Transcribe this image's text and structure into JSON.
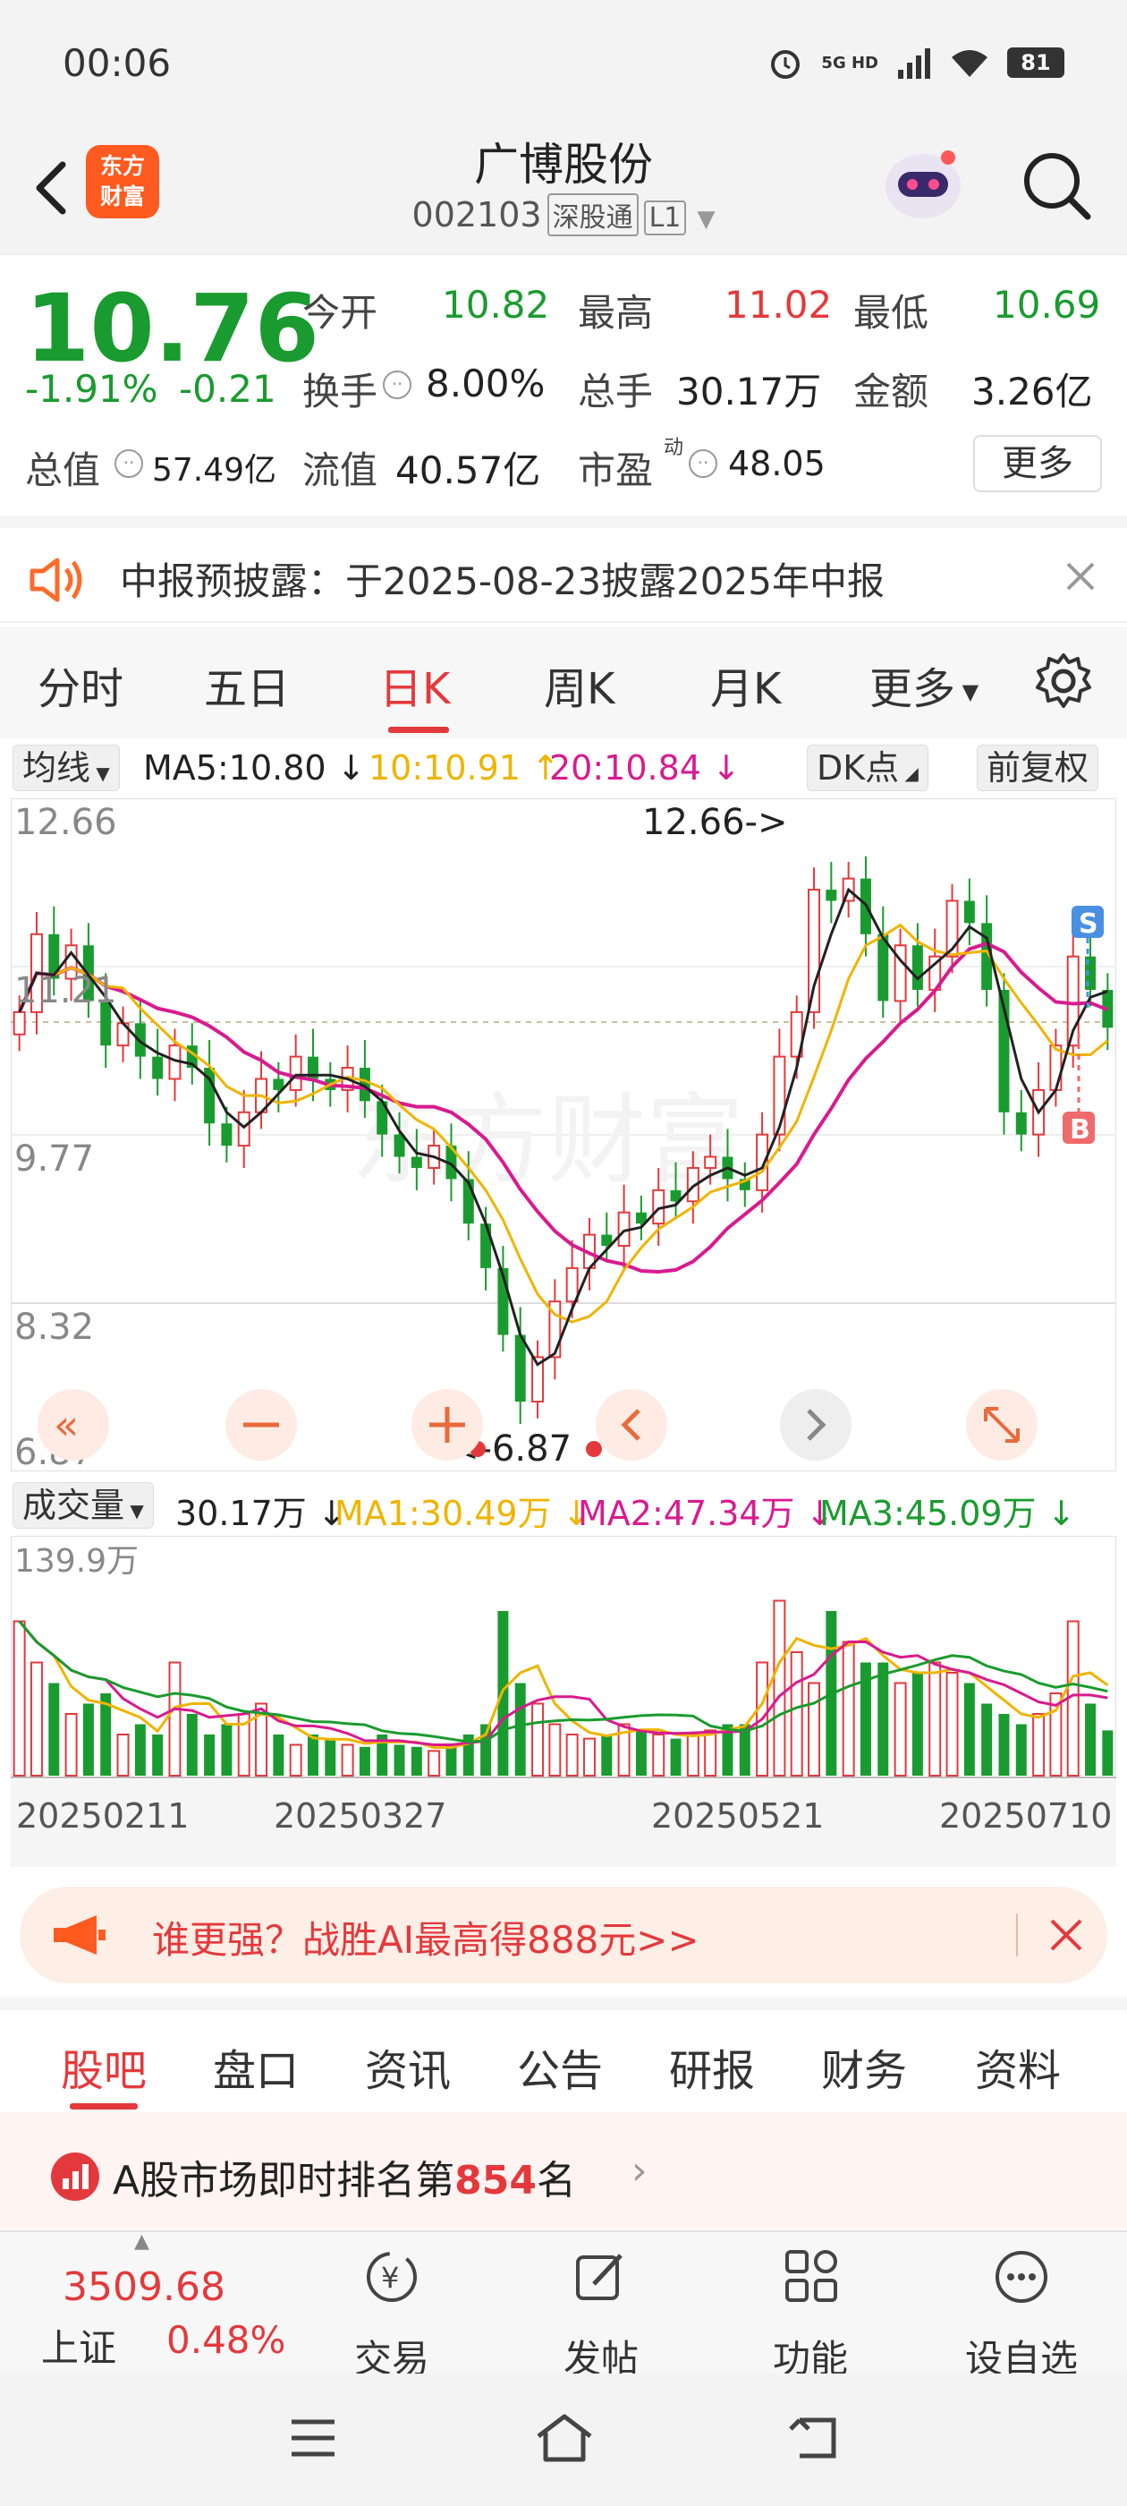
{
  "status_bar": {
    "time": "00:06",
    "network": "5G HD",
    "battery": "81"
  },
  "header": {
    "logo_text": "东方财富",
    "title": "广博股份",
    "code": "002103",
    "tag_connect": "深股通",
    "tag_level": "L1"
  },
  "quote": {
    "price": "10.76",
    "change_pct": "-1.91%",
    "change": "-0.21",
    "open_label": "今开",
    "open": "10.82",
    "high_label": "最高",
    "high": "11.02",
    "low_label": "最低",
    "low": "10.69",
    "turnover_label": "换手",
    "turnover": "8.00%",
    "volume_label": "总手",
    "volume": "30.17万",
    "amount_label": "金额",
    "amount": "3.26亿",
    "mktcap_label": "总值",
    "mktcap": "57.49亿",
    "float_label": "流值",
    "float_cap": "40.57亿",
    "pe_label": "市盈",
    "pe_sup": "动",
    "pe": "48.05",
    "more_label": "更多"
  },
  "notice": {
    "text": "中报预披露：于2025-08-23披露2025年中报"
  },
  "chart_tabs": [
    "分时",
    "五日",
    "日K",
    "周K",
    "月K",
    "更多"
  ],
  "active_chart_tab": "日K",
  "ma_row": {
    "indicator": "均线",
    "ma5": "MA5:10.80 ↓",
    "ma10": "10:10.91 ↑",
    "ma20": "20:10.84 ↓",
    "dk_label": "DK点",
    "adjust_label": "前复权"
  },
  "volume_row": {
    "indicator": "成交量",
    "value": "30.17万 ↓",
    "ma1": "MA1:30.49万 ↓",
    "ma2": "MA2:47.34万 ↓",
    "ma3": "MA3:45.09万 ↓"
  },
  "colors": {
    "up": "#e4393c",
    "down": "#1a9b2f",
    "ma5": "#222222",
    "ma10": "#f0b400",
    "ma20": "#d81b8f",
    "accent": "#e4393c"
  },
  "chart_data": {
    "type": "candlestick",
    "y_ticks": [
      "12.66",
      "11.21",
      "9.77",
      "8.32",
      "6.87"
    ],
    "ylim": [
      6.87,
      12.66
    ],
    "x_labels": [
      "20250211",
      "20250327",
      "20250521",
      "20250710"
    ],
    "annotation_high": "12.66->",
    "annotation_low": "<-6.87",
    "signals": [
      "S",
      "B"
    ],
    "volume_max_label": "139.9万",
    "close": [
      10.9,
      11.6,
      11.2,
      11.5,
      11.0,
      10.6,
      10.8,
      10.5,
      10.3,
      10.6,
      10.4,
      9.9,
      9.7,
      10.0,
      10.3,
      10.2,
      10.5,
      10.3,
      10.2,
      10.4,
      10.1,
      9.8,
      9.6,
      9.5,
      9.7,
      9.4,
      9.0,
      8.6,
      8.0,
      7.4,
      7.8,
      8.3,
      8.6,
      8.9,
      8.8,
      9.1,
      9.0,
      9.3,
      9.2,
      9.5,
      9.6,
      9.4,
      9.3,
      9.8,
      10.5,
      10.9,
      12.0,
      11.9,
      12.1,
      11.6,
      11.0,
      11.5,
      11.1,
      11.4,
      11.9,
      11.7,
      11.1,
      10.0,
      9.8,
      10.2,
      10.6,
      11.4,
      11.1,
      10.76
    ],
    "volume_rel": [
      0.75,
      0.55,
      0.45,
      0.3,
      0.35,
      0.4,
      0.2,
      0.25,
      0.2,
      0.55,
      0.3,
      0.2,
      0.25,
      0.3,
      0.35,
      0.2,
      0.15,
      0.2,
      0.18,
      0.15,
      0.14,
      0.2,
      0.15,
      0.14,
      0.12,
      0.15,
      0.2,
      0.25,
      0.8,
      0.45,
      0.35,
      0.25,
      0.2,
      0.18,
      0.2,
      0.25,
      0.22,
      0.2,
      0.18,
      0.2,
      0.22,
      0.25,
      0.25,
      0.55,
      0.85,
      0.6,
      0.45,
      0.8,
      0.65,
      0.55,
      0.55,
      0.45,
      0.5,
      0.55,
      0.5,
      0.45,
      0.35,
      0.3,
      0.25,
      0.3,
      0.4,
      0.75,
      0.35,
      0.22
    ]
  },
  "promo": {
    "text": "谁更强？战胜AI最高得888元>>"
  },
  "bottom_tabs": [
    "股吧",
    "盘口",
    "资讯",
    "公告",
    "研报",
    "财务",
    "资料"
  ],
  "active_bottom_tab": "股吧",
  "ranking": {
    "prefix": "A股市场即时排名第",
    "rank": "854",
    "suffix": "名"
  },
  "bottom_nav": {
    "index_value": "3509.68",
    "index_name": "上证",
    "index_change": "0.48%",
    "items": [
      "交易",
      "发帖",
      "功能",
      "设自选"
    ]
  }
}
